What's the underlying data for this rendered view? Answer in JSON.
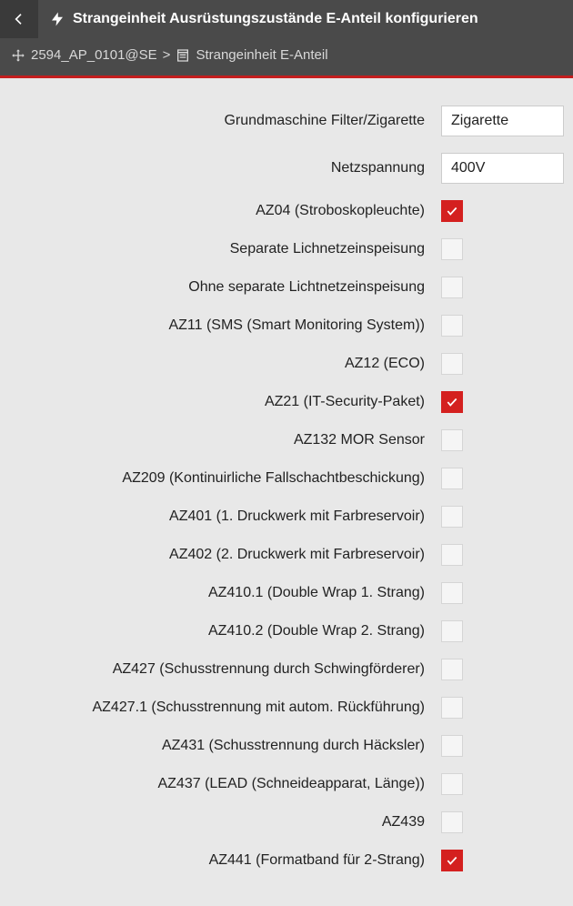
{
  "header": {
    "title": "Strangeinheit Ausrüstungszustände E-Anteil konfigurieren"
  },
  "breadcrumb": {
    "item1": "2594_AP_0101@SE",
    "separator": ">",
    "item2": "Strangeinheit E-Anteil"
  },
  "form": {
    "selects": [
      {
        "label": "Grundmaschine Filter/Zigarette",
        "value": "Zigarette"
      },
      {
        "label": "Netzspannung",
        "value": "400V"
      }
    ],
    "checkboxes": [
      {
        "label": "AZ04 (Stroboskopleuchte)",
        "checked": true
      },
      {
        "label": "Separate Lichnetzeinspeisung",
        "checked": false
      },
      {
        "label": "Ohne separate Lichtnetzeinspeisung",
        "checked": false
      },
      {
        "label": "AZ11 (SMS (Smart Monitoring System))",
        "checked": false
      },
      {
        "label": "AZ12 (ECO)",
        "checked": false
      },
      {
        "label": "AZ21 (IT-Security-Paket)",
        "checked": true
      },
      {
        "label": "AZ132 MOR Sensor",
        "checked": false
      },
      {
        "label": "AZ209 (Kontinuirliche Fallschachtbeschickung)",
        "checked": false
      },
      {
        "label": "AZ401 (1. Druckwerk mit Farbreservoir)",
        "checked": false
      },
      {
        "label": "AZ402 (2. Druckwerk mit Farbreservoir)",
        "checked": false
      },
      {
        "label": "AZ410.1 (Double Wrap 1. Strang)",
        "checked": false
      },
      {
        "label": "AZ410.2 (Double Wrap 2. Strang)",
        "checked": false
      },
      {
        "label": "AZ427 (Schusstrennung durch Schwingförderer)",
        "checked": false
      },
      {
        "label": "AZ427.1 (Schusstrennung mit autom. Rückführung)",
        "checked": false
      },
      {
        "label": "AZ431 (Schusstrennung durch Häcksler)",
        "checked": false
      },
      {
        "label": "AZ437 (LEAD (Schneideapparat, Länge))",
        "checked": false
      },
      {
        "label": "AZ439",
        "checked": false
      },
      {
        "label": "AZ441 (Formatband für 2-Strang)",
        "checked": true
      }
    ]
  }
}
